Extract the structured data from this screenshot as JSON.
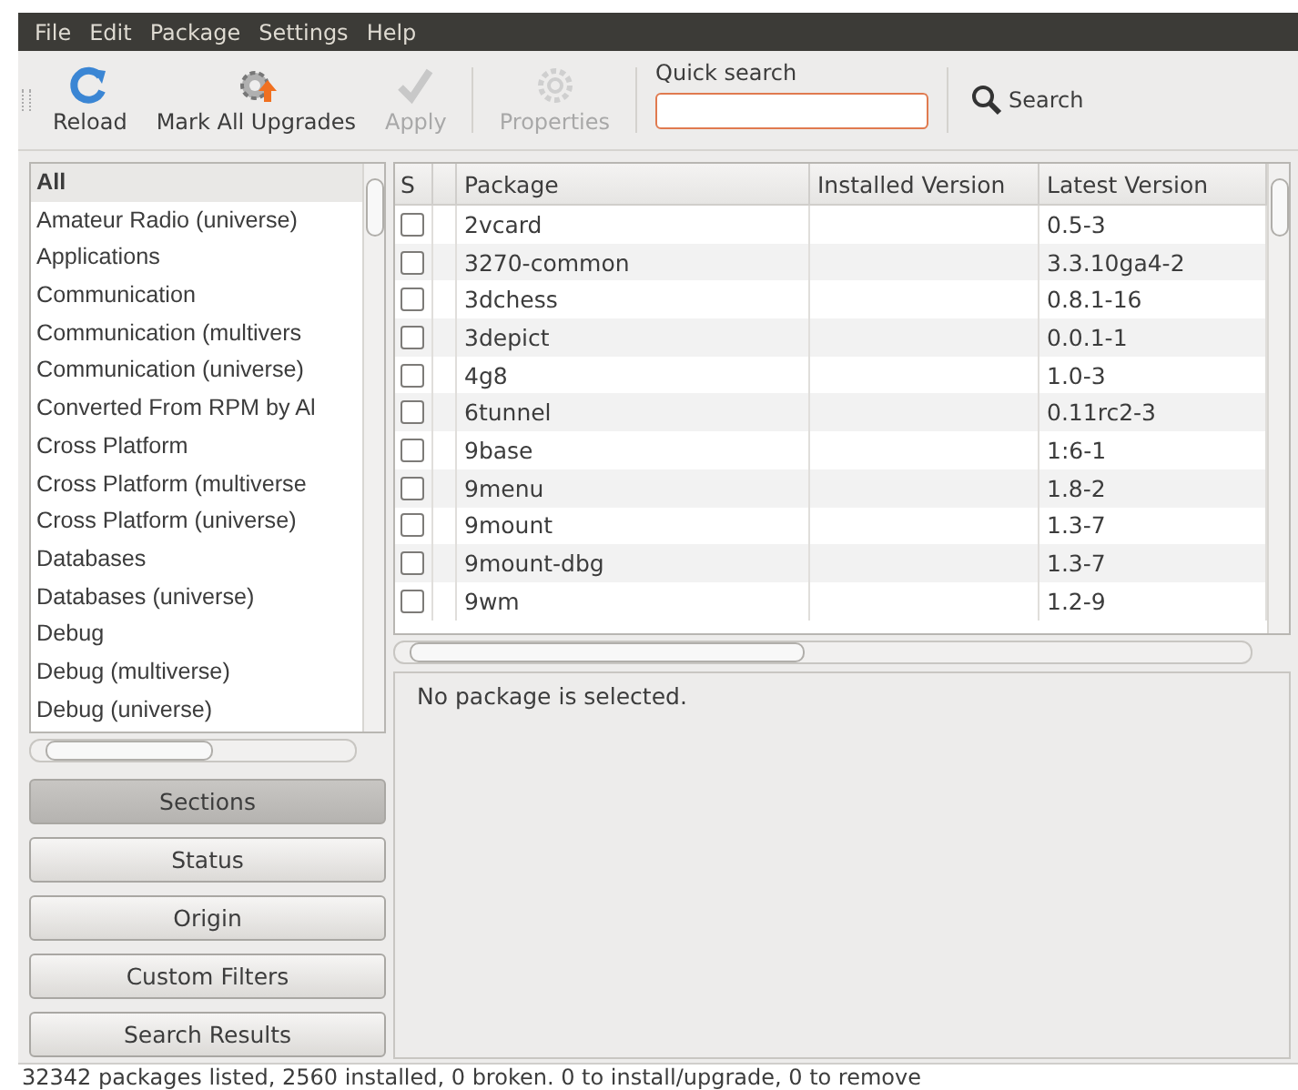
{
  "menu": [
    "File",
    "Edit",
    "Package",
    "Settings",
    "Help"
  ],
  "toolbar": [
    {
      "label": "Reload",
      "disabled": false
    },
    {
      "label": "Mark All Upgrades",
      "disabled": false
    },
    {
      "label": "Apply",
      "disabled": true
    },
    {
      "label": "Properties",
      "disabled": true
    }
  ],
  "quick_search": {
    "label": "Quick search"
  },
  "search_button": "Search",
  "sections": [
    {
      "label": "All",
      "selected": true
    },
    {
      "label": "Amateur Radio (universe)",
      "selected": false
    },
    {
      "label": "Applications",
      "selected": false
    },
    {
      "label": "Communication",
      "selected": false
    },
    {
      "label": "Communication (multivers",
      "selected": false
    },
    {
      "label": "Communication (universe)",
      "selected": false
    },
    {
      "label": "Converted From RPM by Al",
      "selected": false
    },
    {
      "label": "Cross Platform",
      "selected": false
    },
    {
      "label": "Cross Platform (multiverse",
      "selected": false
    },
    {
      "label": "Cross Platform (universe)",
      "selected": false
    },
    {
      "label": "Databases",
      "selected": false
    },
    {
      "label": "Databases (universe)",
      "selected": false
    },
    {
      "label": "Debug",
      "selected": false
    },
    {
      "label": "Debug (multiverse)",
      "selected": false
    },
    {
      "label": "Debug (universe)",
      "selected": false
    }
  ],
  "filter_buttons": [
    {
      "label": "Sections",
      "selected": true
    },
    {
      "label": "Status",
      "selected": false
    },
    {
      "label": "Origin",
      "selected": false
    },
    {
      "label": "Custom Filters",
      "selected": false
    },
    {
      "label": "Search Results",
      "selected": false
    }
  ],
  "table": {
    "columns": [
      "S",
      "Package",
      "Installed Version",
      "Latest Version"
    ],
    "rows": [
      {
        "checked": false,
        "package": "2vcard",
        "latest": "0.5-3"
      },
      {
        "checked": false,
        "package": "3270-common",
        "latest": "3.3.10ga4-2"
      },
      {
        "checked": false,
        "package": "3dchess",
        "latest": "0.8.1-16"
      },
      {
        "checked": false,
        "package": "3depict",
        "latest": "0.0.1-1"
      },
      {
        "checked": false,
        "package": "4g8",
        "latest": "1.0-3"
      },
      {
        "checked": false,
        "package": "6tunnel",
        "latest": "0.11rc2-3"
      },
      {
        "checked": false,
        "package": "9base",
        "latest": "1:6-1"
      },
      {
        "checked": false,
        "package": "9menu",
        "latest": "1.8-2"
      },
      {
        "checked": false,
        "package": "9mount",
        "latest": "1.3-7"
      },
      {
        "checked": false,
        "package": "9mount-dbg",
        "latest": "1.3-7"
      },
      {
        "checked": false,
        "package": "9wm",
        "latest": "1.2-9"
      }
    ]
  },
  "details": "No package is selected.",
  "status_bar": "32342 packages listed, 2560 installed, 0 broken. 0 to install/upgrade, 0 to remove"
}
